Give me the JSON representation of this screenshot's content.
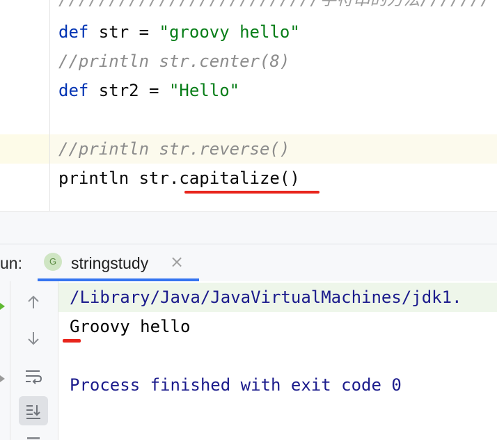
{
  "editor": {
    "top_comment": "//////////////////////////字符串的方法///////",
    "line1": {
      "kw": "def",
      "rest": " str = ",
      "str": "\"groovy hello\""
    },
    "line2": "//println str.center(8)",
    "line3": {
      "kw": "def",
      "rest": " str2 = ",
      "str": "\"Hello\""
    },
    "line5": "//println str.reverse()",
    "line6": "println str.capitalize()"
  },
  "run_panel": {
    "label": "un:",
    "tab": {
      "icon_letter": "G",
      "title": "stringstudy",
      "close_glyph": "×"
    }
  },
  "console": {
    "command": "/Library/Java/JavaVirtualMachines/jdk1.",
    "output": "Groovy hello",
    "exit_message": "Process finished with exit code 0"
  },
  "colors": {
    "keyword": "#0033b3",
    "string": "#067d17",
    "comment": "#8c8c8c",
    "annotation_red": "#e8251c",
    "console_text": "#1b1b8c",
    "tab_accent": "#3574f0"
  },
  "icons": [
    "scroll-up-icon",
    "scroll-down-icon",
    "soft-wrap-icon",
    "scroll-to-end-icon",
    "run-icon",
    "groovy-file-icon",
    "close-icon"
  ]
}
